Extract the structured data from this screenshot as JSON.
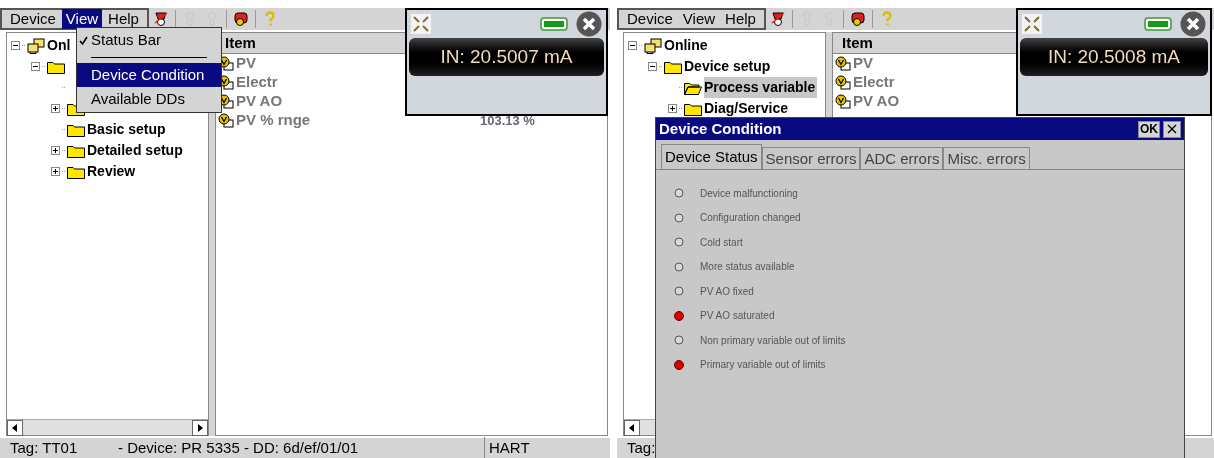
{
  "screens": [
    {
      "menu": [
        {
          "label": "Device",
          "selected": false
        },
        {
          "label": "View",
          "selected": true
        },
        {
          "label": "Help",
          "selected": false
        }
      ],
      "toolbar": [
        {
          "kind": "pin",
          "disabled": false
        },
        {
          "kind": "probe",
          "disabled": true
        },
        {
          "kind": "probe",
          "disabled": true
        },
        {
          "kind": "device",
          "disabled": false
        },
        {
          "kind": "help",
          "disabled": false
        }
      ],
      "tree": [
        {
          "kind": "online",
          "label": "Onl",
          "expanded": true,
          "selected": false,
          "children": [
            {
              "kind": "folder",
              "expanded": true,
              "selected": false,
              "children": [
                {
                  "kind": "hidden",
                  "selected": false
                },
                {
                  "kind": "folder",
                  "expanded": false,
                  "selected": false
                },
                {
                  "kind": "folder",
                  "label": "Basic setup",
                  "selected": false
                },
                {
                  "kind": "folder",
                  "label": "Detailed setup",
                  "expanded": false,
                  "selected": false
                },
                {
                  "kind": "folder",
                  "label": "Review",
                  "expanded": false,
                  "selected": false
                }
              ]
            }
          ]
        }
      ],
      "list": {
        "column": "Item",
        "rows": [
          {
            "label": "PV"
          },
          {
            "label": "Electr"
          },
          {
            "label": "PV AO"
          },
          {
            "label": "PV % rnge",
            "value": "103.13 %"
          }
        ]
      },
      "readout": "IN: 20.5007 mA",
      "status": {
        "tag": "Tag: TT01",
        "device": "- Device: PR 5335 - DD: 6d/ef/01/01",
        "protocol": "HART"
      },
      "dropdown": [
        {
          "kind": "check",
          "label": "Status Bar",
          "checked": true
        },
        {
          "kind": "separator"
        },
        {
          "kind": "item",
          "label": "Device Condition",
          "selected": true
        },
        {
          "kind": "item",
          "label": "Available DDs",
          "selected": false
        }
      ]
    },
    {
      "menu": [
        {
          "label": "Device",
          "selected": false
        },
        {
          "label": "View",
          "selected": false
        },
        {
          "label": "Help",
          "selected": false
        }
      ],
      "toolbar": [
        {
          "kind": "pin",
          "disabled": false
        },
        {
          "kind": "probe",
          "disabled": true
        },
        {
          "kind": "probe",
          "disabled": true
        },
        {
          "kind": "device",
          "disabled": false
        },
        {
          "kind": "help",
          "disabled": false
        }
      ],
      "tree": [
        {
          "kind": "online",
          "label": "Online",
          "expanded": true,
          "selected": false,
          "children": [
            {
              "kind": "folder",
              "label": "Device setup",
              "expanded": true,
              "selected": false,
              "children": [
                {
                  "kind": "folder-open",
                  "label": "Process variable",
                  "selected": true
                },
                {
                  "kind": "folder",
                  "label": "Diag/Service",
                  "expanded": false,
                  "selected": false
                }
              ]
            }
          ]
        }
      ],
      "list": {
        "column": "Item",
        "rows": [
          {
            "label": "PV"
          },
          {
            "label": "Electr"
          },
          {
            "label": "PV AO"
          }
        ]
      },
      "readout": "IN: 20.5008 mA",
      "status": {
        "tag": "Tag:"
      },
      "dialog": {
        "title": "Device Condition",
        "ok": "OK",
        "tabs": [
          {
            "label": "Device Status",
            "selected": true
          },
          {
            "label": "Sensor errors",
            "selected": false
          },
          {
            "label": "ADC errors",
            "selected": false
          },
          {
            "label": "Misc. errors",
            "selected": false
          }
        ],
        "items": [
          {
            "label": "Device malfunctioning",
            "on": false
          },
          {
            "label": "Configuration changed",
            "on": false
          },
          {
            "label": "Cold start",
            "on": false
          },
          {
            "label": "More status available",
            "on": false
          },
          {
            "label": "PV AO fixed",
            "on": false
          },
          {
            "label": "PV AO saturated",
            "on": true
          },
          {
            "label": "Non primary variable out of limits",
            "on": false
          },
          {
            "label": "Primary variable out of limits",
            "on": true
          }
        ]
      }
    }
  ]
}
